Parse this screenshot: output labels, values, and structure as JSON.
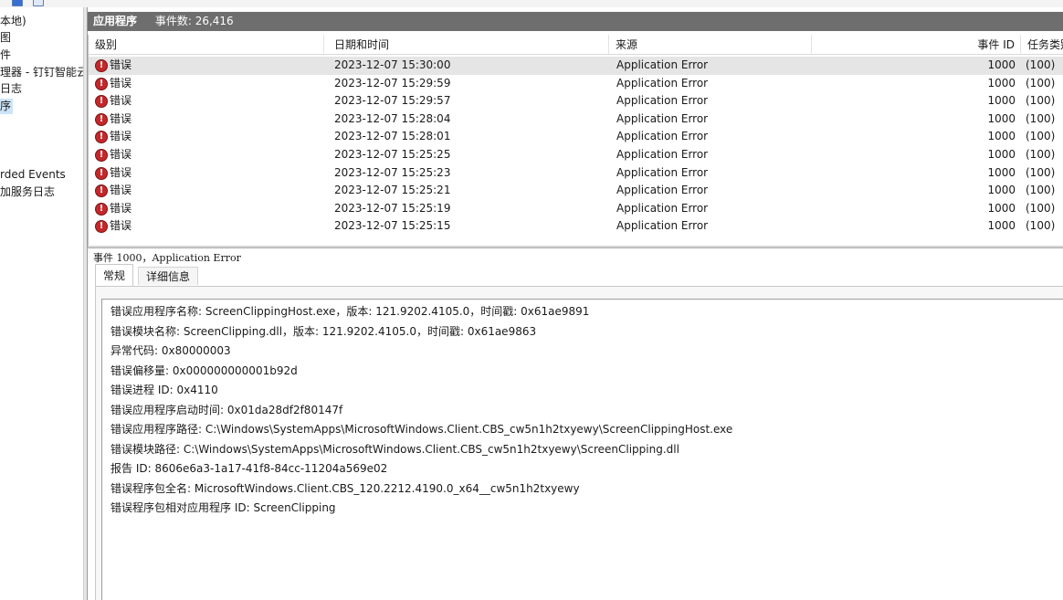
{
  "tree": {
    "items": [
      {
        "label": "本地)",
        "selected": false
      },
      {
        "label": "图",
        "selected": false
      },
      {
        "label": "件",
        "selected": false
      },
      {
        "label": "理器 - 钉钉智能云",
        "selected": false
      },
      {
        "label": " 日志",
        "selected": false
      },
      {
        "label": "序",
        "selected": true
      },
      {
        "label": "",
        "selected": false
      },
      {
        "label": "",
        "selected": false
      },
      {
        "label": "rded Events",
        "selected": false
      },
      {
        "label": "加服务日志",
        "selected": false
      }
    ]
  },
  "main": {
    "title": "应用程序",
    "event_count_label": "事件数: 26,416"
  },
  "grid": {
    "columns": [
      "级别",
      "日期和时间",
      "来源",
      "",
      "事件 ID",
      "任务类别"
    ],
    "rows": [
      {
        "level": "错误",
        "datetime": "2023-12-07 15:30:00",
        "source": "Application Error",
        "event_id": "1000",
        "task": "(100)"
      },
      {
        "level": "错误",
        "datetime": "2023-12-07 15:29:59",
        "source": "Application Error",
        "event_id": "1000",
        "task": "(100)"
      },
      {
        "level": "错误",
        "datetime": "2023-12-07 15:29:57",
        "source": "Application Error",
        "event_id": "1000",
        "task": "(100)"
      },
      {
        "level": "错误",
        "datetime": "2023-12-07 15:28:04",
        "source": "Application Error",
        "event_id": "1000",
        "task": "(100)"
      },
      {
        "level": "错误",
        "datetime": "2023-12-07 15:28:01",
        "source": "Application Error",
        "event_id": "1000",
        "task": "(100)"
      },
      {
        "level": "错误",
        "datetime": "2023-12-07 15:25:25",
        "source": "Application Error",
        "event_id": "1000",
        "task": "(100)"
      },
      {
        "level": "错误",
        "datetime": "2023-12-07 15:25:23",
        "source": "Application Error",
        "event_id": "1000",
        "task": "(100)"
      },
      {
        "level": "错误",
        "datetime": "2023-12-07 15:25:21",
        "source": "Application Error",
        "event_id": "1000",
        "task": "(100)"
      },
      {
        "level": "错误",
        "datetime": "2023-12-07 15:25:19",
        "source": "Application Error",
        "event_id": "1000",
        "task": "(100)"
      },
      {
        "level": "错误",
        "datetime": "2023-12-07 15:25:15",
        "source": "Application Error",
        "event_id": "1000",
        "task": "(100)"
      }
    ],
    "error_icon": "error-circle-icon",
    "error_color": "#c4282b"
  },
  "detail": {
    "title": "事件 1000，Application Error",
    "tabs": [
      "常规",
      "详细信息"
    ],
    "lines": [
      "错误应用程序名称: ScreenClippingHost.exe，版本: 121.9202.4105.0，时间戳: 0x61ae9891",
      "错误模块名称: ScreenClipping.dll，版本: 121.9202.4105.0，时间戳: 0x61ae9863",
      "异常代码: 0x80000003",
      "错误偏移量: 0x000000000001b92d",
      "错误进程 ID: 0x4110",
      "错误应用程序启动时间: 0x01da28df2f80147f",
      "错误应用程序路径: C:\\Windows\\SystemApps\\MicrosoftWindows.Client.CBS_cw5n1h2txyewy\\ScreenClippingHost.exe",
      "错误模块路径: C:\\Windows\\SystemApps\\MicrosoftWindows.Client.CBS_cw5n1h2txyewy\\ScreenClipping.dll",
      "报告 ID: 8606e6a3-1a17-41f8-84cc-11204a569e02",
      "错误程序包全名: MicrosoftWindows.Client.CBS_120.2212.4190.0_x64__cw5n1h2txyewy",
      "错误程序包相对应用程序 ID: ScreenClipping"
    ]
  }
}
